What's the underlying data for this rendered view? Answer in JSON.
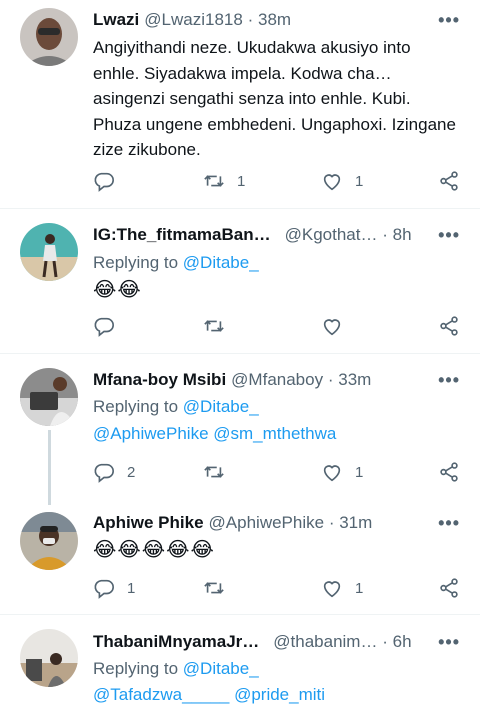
{
  "tweets": [
    {
      "name": "Lwazi",
      "handle": "@Lwazi1818",
      "sep": "·",
      "time": "38m",
      "text": "Angiyithandi neze. Ukudakwa akusiyo into enhle. Siyadakwa impela. Kodwa cha… asingenzi sengathi senza into enhle. Kubi. Phuza ungene embhedeni. Ungaphoxi. Izingane zize zikubone.",
      "replies": "",
      "retweets": "1",
      "likes": "1"
    },
    {
      "name": "IG:The_fitmamaBan…",
      "handle": "@Kgothat…",
      "sep": "·",
      "time": "8h",
      "replying_prefix": "Replying to",
      "replying_to": "@Ditabe_",
      "text": "😂😂",
      "replies": "",
      "retweets": "",
      "likes": ""
    },
    {
      "name": "Mfana-boy Msibi",
      "handle": "@Mfanaboy",
      "sep": "·",
      "time": "33m",
      "replying_prefix": "Replying to",
      "replying_to": "@Ditabe_",
      "replying_more": "@AphiwePhike @sm_mthethwa",
      "replies": "2",
      "retweets": "",
      "likes": "1"
    },
    {
      "name": "Aphiwe Phike",
      "handle": "@AphiwePhike",
      "sep": "·",
      "time": "31m",
      "text": "😂😂😂😂😂",
      "replies": "1",
      "retweets": "",
      "likes": "1"
    },
    {
      "name": "ThabaniMnyamaJr…",
      "handle": "@thabanim…",
      "sep": "·",
      "time": "6h",
      "replying_prefix": "Replying to",
      "replying_to": "@Ditabe_",
      "replying_more": "@Tafadzwa_____ @pride_miti"
    }
  ],
  "more_label": "•••",
  "icons": {
    "reply": "reply-icon",
    "retweet": "retweet-icon",
    "like": "heart-icon",
    "share": "share-icon",
    "more": "more-icon"
  },
  "colors": {
    "text": "#0f1419",
    "muted": "#536471",
    "link": "#1d9bf0",
    "divider": "#eff3f4"
  }
}
